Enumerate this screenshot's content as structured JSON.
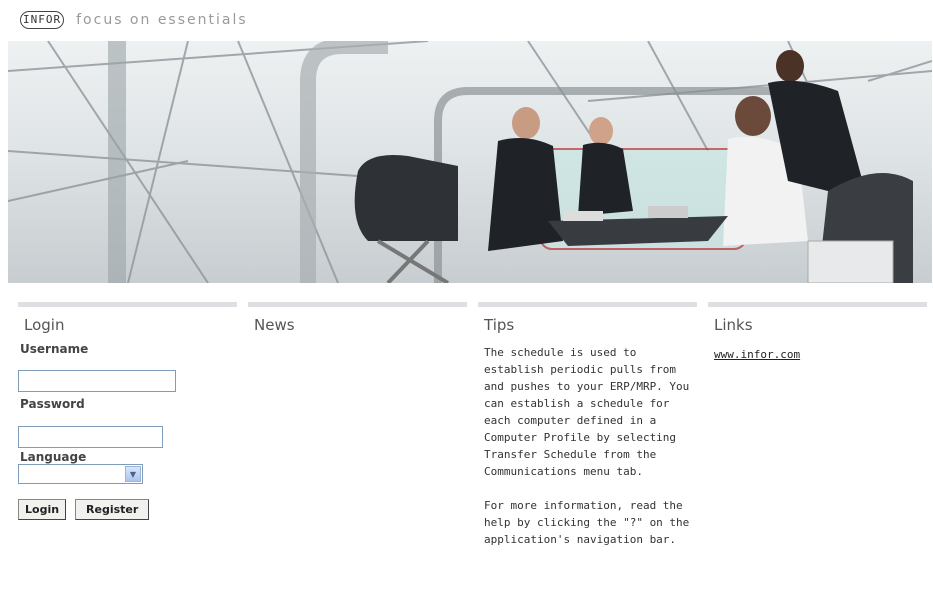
{
  "header": {
    "logo_text": "INFOR",
    "tagline": "focus on essentials"
  },
  "banner": {
    "image_alt": "business team meeting photo"
  },
  "login": {
    "heading": "Login",
    "username_label": "Username",
    "username_value": "",
    "password_label": "Password",
    "password_value": "",
    "language_label": "Language",
    "language_value": "",
    "login_button": "Login",
    "register_button": "Register"
  },
  "news": {
    "heading": "News"
  },
  "tips": {
    "heading": "Tips",
    "paragraph1": "The schedule is used to establish periodic pulls from and pushes to your ERP/MRP. You can establish a schedule for each computer defined in a Computer Profile by selecting Transfer Schedule from the Communications menu tab.",
    "paragraph2": "For more information, read the help by clicking the \"?\" on the application's navigation bar."
  },
  "links": {
    "heading": "Links",
    "items": [
      "www.infor.com"
    ]
  }
}
